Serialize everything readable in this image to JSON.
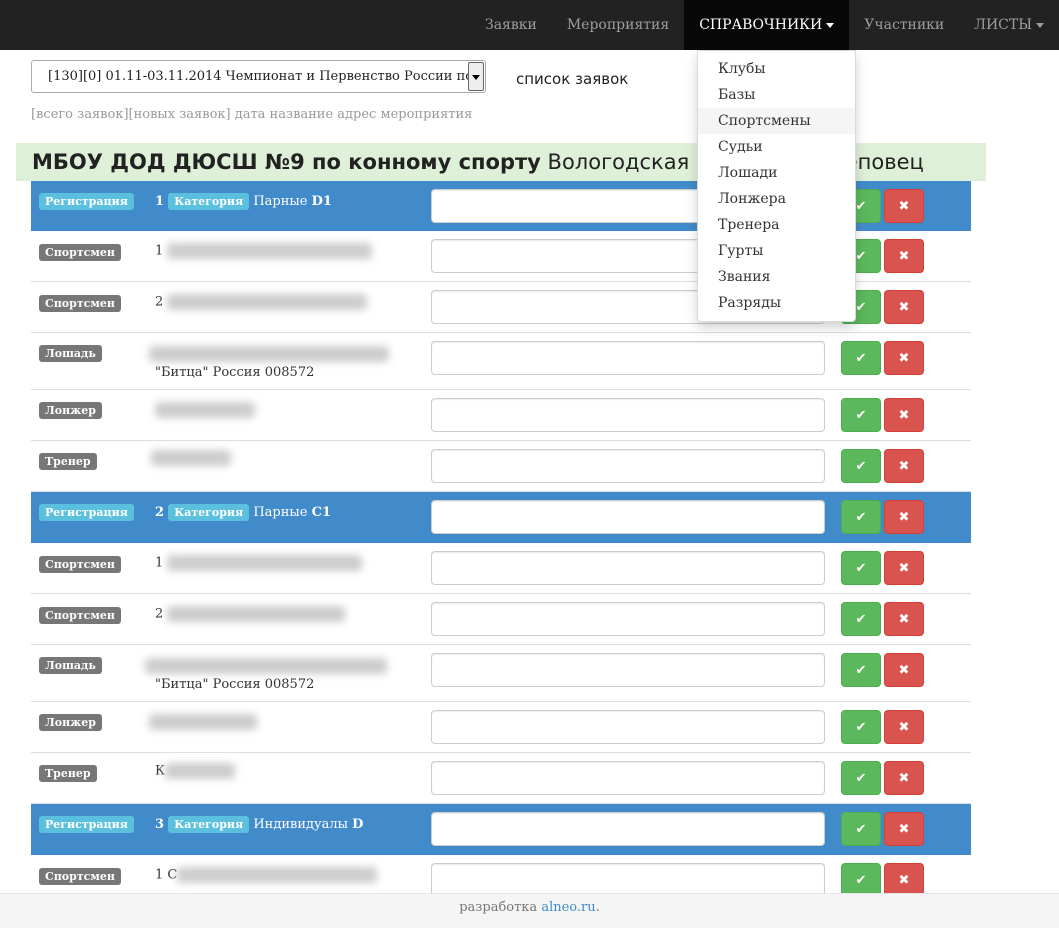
{
  "nav": {
    "items": [
      {
        "label": "Заявки",
        "active": false,
        "caret": false
      },
      {
        "label": "Мероприятия",
        "active": false,
        "caret": false
      },
      {
        "label": "СПРАВОЧНИКИ",
        "active": true,
        "caret": true
      },
      {
        "label": "Участники",
        "active": false,
        "caret": false
      },
      {
        "label": "ЛИСТЫ",
        "active": false,
        "caret": true
      }
    ],
    "dropdown": [
      "Клубы",
      "Базы",
      "Спортсмены",
      "Судьи",
      "Лошади",
      "Лонжера",
      "Тренера",
      "Гурты",
      "Звания",
      "Разряды"
    ],
    "dropdown_hover": "Спортсмены"
  },
  "event_select": {
    "value": "[130][0] 01.11-03.11.2014 Чемпионат и Первенство России по"
  },
  "list_title": "список заявок",
  "hint": "[всего заявок][новых заявок] дата название адрес мероприятия",
  "club": {
    "name_bold": "МБОУ ДОД ДЮСШ №9 по конному спорту",
    "name_rest": "Вологодская о",
    "name_tail": "еповец"
  },
  "labels": {
    "registration": "Регистрация",
    "category": "Категория",
    "sportsman": "Спортсмен",
    "horse": "Лошадь",
    "longeur": "Лонжер",
    "trainer": "Тренер"
  },
  "icons": {
    "ok": "check-icon",
    "del": "close-icon"
  },
  "colors": {
    "navbar": "#222222",
    "registration_row": "#428bca",
    "club_banner": "#dff0d8",
    "ok_button": "#5cb85c",
    "delete_button": "#d9534f"
  },
  "groups": [
    {
      "num": "1",
      "category": "Парные",
      "category_code": "D1",
      "sportsmen": [
        {
          "num": "1",
          "text": ""
        },
        {
          "num": "2",
          "text": ""
        }
      ],
      "horse_info": "\"Битца\" Россия 008572",
      "trainer_text": ""
    },
    {
      "num": "2",
      "category": "Парные",
      "category_code": "C1",
      "sportsmen": [
        {
          "num": "1",
          "text": ""
        },
        {
          "num": "2",
          "text": ""
        }
      ],
      "horse_info": "\"Битца\" Россия 008572",
      "trainer_text": "К"
    },
    {
      "num": "3",
      "category": "Индивидуалы",
      "category_code": "D",
      "sportsmen": [
        {
          "num": "1",
          "text": "С"
        }
      ]
    }
  ],
  "footer": {
    "prefix": "разработка",
    "link": "alneo.ru",
    "suffix": "."
  }
}
